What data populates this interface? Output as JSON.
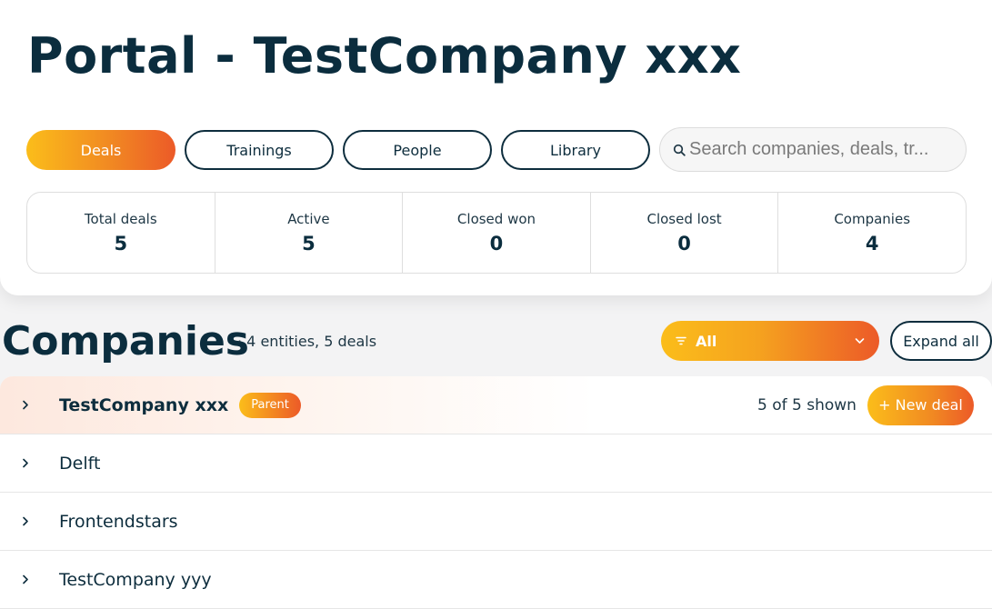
{
  "header": {
    "title": "Portal - TestCompany xxx"
  },
  "tabs": [
    {
      "label": "Deals",
      "active": true
    },
    {
      "label": "Trainings",
      "active": false
    },
    {
      "label": "People",
      "active": false
    },
    {
      "label": "Library",
      "active": false
    }
  ],
  "search": {
    "placeholder": "Search companies, deals, tr...",
    "icon": "search-icon"
  },
  "stats": [
    {
      "label": "Total deals",
      "value": "5"
    },
    {
      "label": "Active",
      "value": "5"
    },
    {
      "label": "Closed won",
      "value": "0"
    },
    {
      "label": "Closed lost",
      "value": "0"
    },
    {
      "label": "Companies",
      "value": "4"
    }
  ],
  "companies": {
    "title": "Companies",
    "subtitle": "· 4 entities, 5 deals",
    "filter_label": "All",
    "expand_label": "Expand all",
    "rows": [
      {
        "name": "TestCompany xxx",
        "badge": "Parent",
        "shown": "5 of 5 shown",
        "new_deal": "+ New deal"
      },
      {
        "name": "Delft"
      },
      {
        "name": "Frontendstars"
      },
      {
        "name": "TestCompany yyy"
      }
    ]
  },
  "colors": {
    "brand_dark": "#0b2d3e",
    "accent_start": "#fbbd1a",
    "accent_end": "#ec5a28"
  }
}
